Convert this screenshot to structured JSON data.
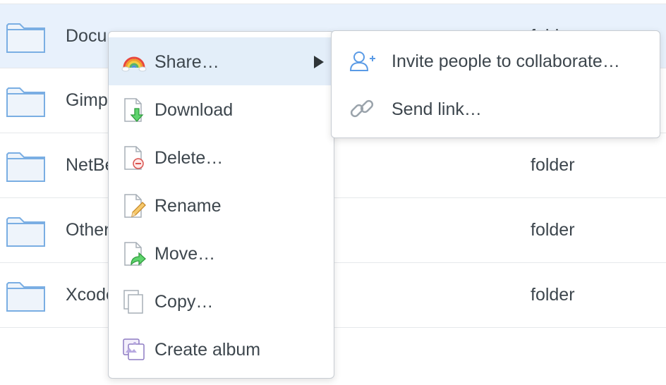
{
  "file_list": {
    "rows": [
      {
        "name": "Documents",
        "kind": "folder"
      },
      {
        "name": "Gimp",
        "kind": ""
      },
      {
        "name": "NetBeans",
        "kind": "folder"
      },
      {
        "name": "Other",
        "kind": "folder"
      },
      {
        "name": "Xcode",
        "kind": "folder"
      }
    ]
  },
  "context_menu": {
    "items": [
      {
        "label": "Share…",
        "icon": "rainbow-icon"
      },
      {
        "label": "Download",
        "icon": "download-icon"
      },
      {
        "label": "Delete…",
        "icon": "delete-icon"
      },
      {
        "label": "Rename",
        "icon": "rename-icon"
      },
      {
        "label": "Move…",
        "icon": "move-icon"
      },
      {
        "label": "Copy…",
        "icon": "copy-icon"
      },
      {
        "label": "Create album",
        "icon": "album-icon"
      }
    ]
  },
  "share_submenu": {
    "items": [
      {
        "label": "Invite people to collaborate…",
        "icon": "add-person-icon"
      },
      {
        "label": "Send link…",
        "icon": "link-icon"
      }
    ]
  },
  "colors": {
    "selected_row": "#e8f1fc",
    "folder_fill": "#eef4fb",
    "folder_stroke": "#7aaee3"
  }
}
